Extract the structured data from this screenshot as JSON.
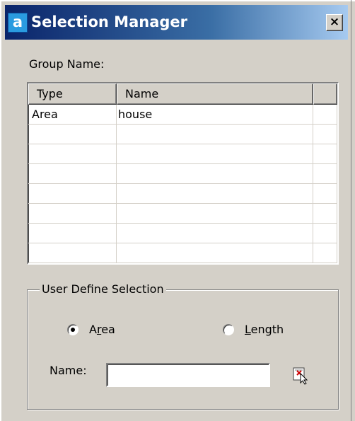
{
  "window": {
    "title": "Selection Manager",
    "icon_letter": "a",
    "close_symbol": "×"
  },
  "group_name_label": "Group Name:",
  "table": {
    "columns": [
      "Type",
      "Name",
      ""
    ],
    "rows": [
      {
        "type": "Area",
        "name": "house"
      },
      {
        "type": "",
        "name": ""
      },
      {
        "type": "",
        "name": ""
      },
      {
        "type": "",
        "name": ""
      },
      {
        "type": "",
        "name": ""
      },
      {
        "type": "",
        "name": ""
      },
      {
        "type": "",
        "name": ""
      },
      {
        "type": "",
        "name": ""
      }
    ]
  },
  "user_define": {
    "title": "User Define Selection",
    "radio_area": "Area",
    "radio_length": "Length",
    "selected": "Area",
    "name_label": "Name:",
    "name_value": ""
  },
  "colors": {
    "dialog_bg": "#d4d0c8",
    "title_start": "#0a246a",
    "title_end": "#a6caf0"
  },
  "icons": {
    "app": "app-logo-icon",
    "close": "close-icon",
    "pick": "pick-entity-icon"
  }
}
